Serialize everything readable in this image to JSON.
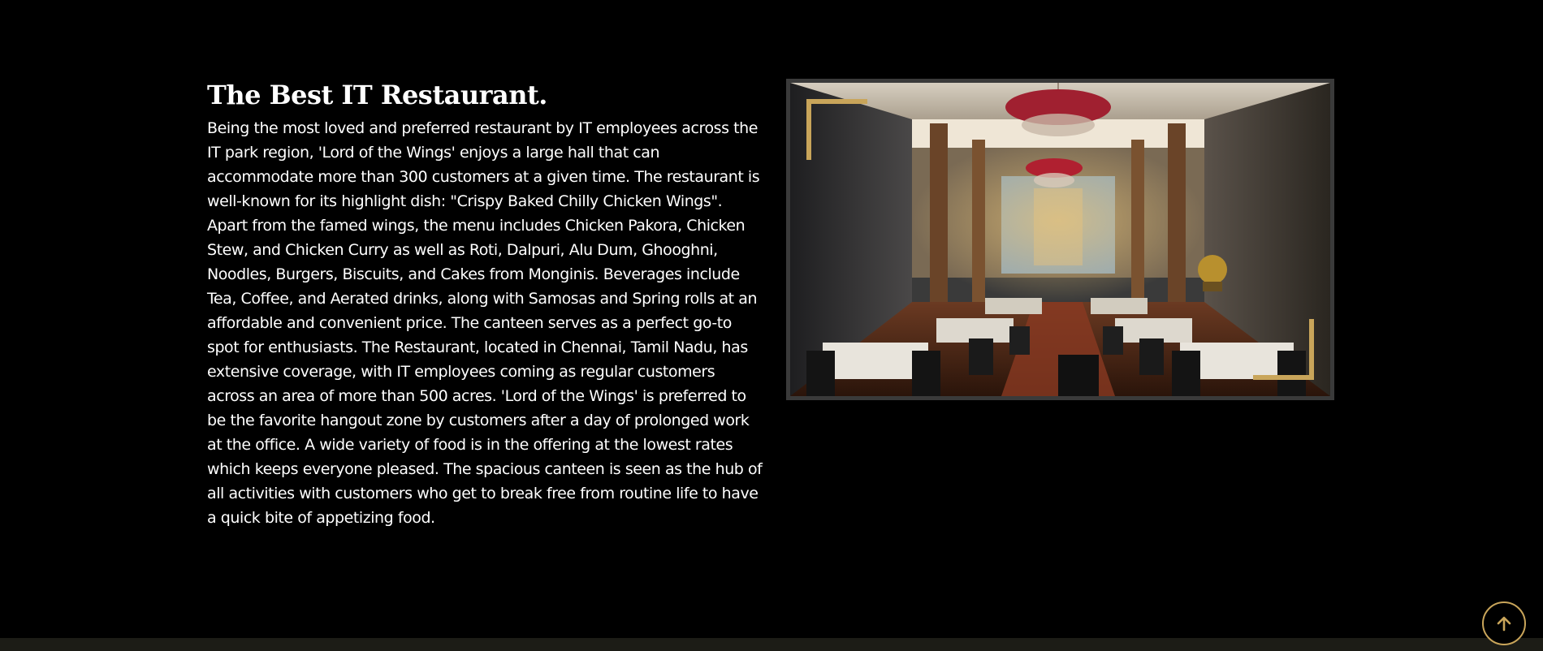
{
  "about": {
    "title": "The Best IT Restaurant.",
    "description": "Being the most loved and preferred restaurant by IT employees across the IT park region, 'Lord of the Wings' enjoys a large hall that can accommodate more than 300 customers at a given time. The restaurant is well-known for its highlight dish: \"Crispy Baked Chilly Chicken Wings\". Apart from the famed wings, the menu includes Chicken Pakora, Chicken Stew, and Chicken Curry as well as Roti, Dalpuri, Alu Dum, Ghooghni, Noodles, Burgers, Biscuits, and Cakes from Monginis. Beverages include Tea, Coffee, and Aerated drinks, along with Samosas and Spring rolls at an affordable and convenient price. The canteen serves as a perfect go-to spot for enthusiasts. The Restaurant, located in Chennai, Tamil Nadu, has extensive coverage, with IT employees coming as regular customers across an area of more than 500 acres. 'Lord of the Wings' is preferred to be the favorite hangout zone by customers after a day of prolonged work at the office. A wide variety of food is in the offering at the lowest rates which keeps everyone pleased. The spacious canteen is seen as the hub of all activities with customers who get to break free from routine life to have a quick bite of appetizing food."
  },
  "image": {
    "subject": "restaurant dining hall interior with chandeliers"
  },
  "back_to_top": {
    "icon": "arrow-up-icon"
  },
  "colors": {
    "background": "#000000",
    "text": "#ffffff",
    "accent_gold": "#c9a55a",
    "frame": "#3a3a3a",
    "footer": "#1c1c16"
  }
}
